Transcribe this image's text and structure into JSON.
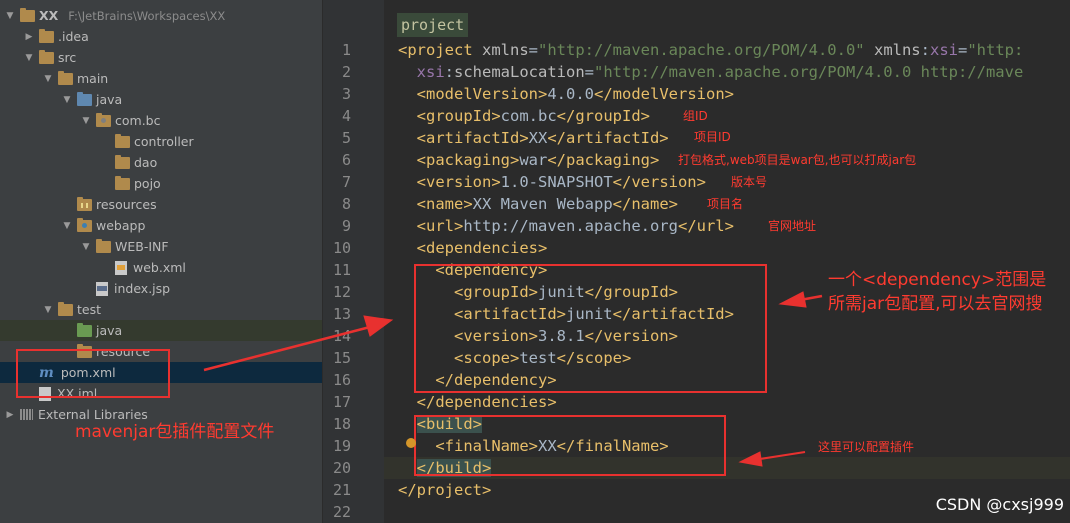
{
  "tree": [
    {
      "label": "XX",
      "extra": "F:\\JetBrains\\Workspaces\\XX",
      "indent": 0,
      "arrow": "▼",
      "icon": "folder",
      "bold": true
    },
    {
      "label": ".idea",
      "indent": 1,
      "arrow": "▶",
      "icon": "folder"
    },
    {
      "label": "src",
      "indent": 1,
      "arrow": "▼",
      "icon": "folder"
    },
    {
      "label": "main",
      "indent": 2,
      "arrow": "▼",
      "icon": "folder"
    },
    {
      "label": "java",
      "indent": 3,
      "arrow": "▼",
      "icon": "folder-blue"
    },
    {
      "label": "com.bc",
      "indent": 4,
      "arrow": "▼",
      "icon": "folder-pkg"
    },
    {
      "label": "controller",
      "indent": 5,
      "arrow": "",
      "icon": "folder"
    },
    {
      "label": "dao",
      "indent": 5,
      "arrow": "",
      "icon": "folder"
    },
    {
      "label": "pojo",
      "indent": 5,
      "arrow": "",
      "icon": "folder"
    },
    {
      "label": "resources",
      "indent": 3,
      "arrow": "",
      "icon": "folder-res"
    },
    {
      "label": "webapp",
      "indent": 3,
      "arrow": "▼",
      "icon": "folder-web"
    },
    {
      "label": "WEB-INF",
      "indent": 4,
      "arrow": "▼",
      "icon": "folder"
    },
    {
      "label": "web.xml",
      "indent": 5,
      "arrow": "",
      "icon": "xml"
    },
    {
      "label": "index.jsp",
      "indent": 4,
      "arrow": "",
      "icon": "jsp"
    },
    {
      "label": "test",
      "indent": 2,
      "arrow": "▼",
      "icon": "folder"
    },
    {
      "label": "java",
      "indent": 3,
      "arrow": "",
      "icon": "folder-green",
      "state": "test-src"
    },
    {
      "label": "resource",
      "indent": 3,
      "arrow": "",
      "icon": "folder"
    },
    {
      "label": "pom.xml",
      "indent": 1,
      "arrow": "",
      "icon": "maven",
      "state": "selected"
    },
    {
      "label": "XX.iml",
      "indent": 1,
      "arrow": "",
      "icon": "iml"
    },
    {
      "label": "External Libraries",
      "indent": 0,
      "arrow": "▶",
      "icon": "libs"
    }
  ],
  "editor": {
    "breadcrumb": "project",
    "line_numbers": [
      "1",
      "2",
      "3",
      "4",
      "5",
      "6",
      "7",
      "8",
      "9",
      "10",
      "11",
      "12",
      "13",
      "14",
      "15",
      "16",
      "17",
      "18",
      "19",
      "20",
      "21",
      "22"
    ],
    "lines": [
      [
        [
          "tag",
          "<project "
        ],
        [
          "attr",
          "xmlns"
        ],
        [
          "txt",
          "="
        ],
        [
          "val",
          "\"http://maven.apache.org/POM/4.0.0\""
        ],
        [
          "txt",
          " "
        ],
        [
          "attr",
          "xmlns"
        ],
        [
          "txt",
          ":"
        ],
        [
          "ns",
          "xsi"
        ],
        [
          "txt",
          "="
        ],
        [
          "val",
          "\"http:"
        ]
      ],
      [
        [
          "txt",
          "  "
        ],
        [
          "ns",
          "xsi"
        ],
        [
          "txt",
          ":"
        ],
        [
          "attr",
          "schemaLocation"
        ],
        [
          "txt",
          "="
        ],
        [
          "val",
          "\"http://maven.apache.org/POM/4.0.0 http://mave"
        ]
      ],
      [
        [
          "txt",
          "  "
        ],
        [
          "tag",
          "<modelVersion>"
        ],
        [
          "txt",
          "4.0.0"
        ],
        [
          "tag",
          "</modelVersion>"
        ]
      ],
      [
        [
          "txt",
          "  "
        ],
        [
          "tag",
          "<groupId>"
        ],
        [
          "txt",
          "com.bc"
        ],
        [
          "tag",
          "</groupId>"
        ]
      ],
      [
        [
          "txt",
          "  "
        ],
        [
          "tag",
          "<artifactId>"
        ],
        [
          "txt",
          "XX"
        ],
        [
          "tag",
          "</artifactId>"
        ]
      ],
      [
        [
          "txt",
          "  "
        ],
        [
          "tag",
          "<packaging>"
        ],
        [
          "txt",
          "war"
        ],
        [
          "tag",
          "</packaging>"
        ]
      ],
      [
        [
          "txt",
          "  "
        ],
        [
          "tag",
          "<version>"
        ],
        [
          "txt",
          "1.0-SNAPSHOT"
        ],
        [
          "tag",
          "</version>"
        ]
      ],
      [
        [
          "txt",
          "  "
        ],
        [
          "tag",
          "<name>"
        ],
        [
          "txt",
          "XX Maven Webapp"
        ],
        [
          "tag",
          "</name>"
        ]
      ],
      [
        [
          "txt",
          "  "
        ],
        [
          "tag",
          "<url>"
        ],
        [
          "txt",
          "http://maven.apache.org"
        ],
        [
          "tag",
          "</url>"
        ]
      ],
      [
        [
          "txt",
          "  "
        ],
        [
          "tag",
          "<dependencies>"
        ]
      ],
      [
        [
          "txt",
          "    "
        ],
        [
          "tag",
          "<dependency>"
        ]
      ],
      [
        [
          "txt",
          "      "
        ],
        [
          "tag",
          "<groupId>"
        ],
        [
          "txt",
          "junit"
        ],
        [
          "tag",
          "</groupId>"
        ]
      ],
      [
        [
          "txt",
          "      "
        ],
        [
          "tag",
          "<artifactId>"
        ],
        [
          "txt",
          "junit"
        ],
        [
          "tag",
          "</artifactId>"
        ]
      ],
      [
        [
          "txt",
          "      "
        ],
        [
          "tag",
          "<version>"
        ],
        [
          "txt",
          "3.8.1"
        ],
        [
          "tag",
          "</version>"
        ]
      ],
      [
        [
          "txt",
          "      "
        ],
        [
          "tag",
          "<scope>"
        ],
        [
          "txt",
          "test"
        ],
        [
          "tag",
          "</scope>"
        ]
      ],
      [
        [
          "txt",
          "    "
        ],
        [
          "tag",
          "</dependency>"
        ]
      ],
      [
        [
          "txt",
          "  "
        ],
        [
          "tag",
          "</dependencies>"
        ]
      ],
      [
        [
          "txt",
          "  "
        ],
        [
          "tag",
          "<build>"
        ]
      ],
      [
        [
          "txt",
          "    "
        ],
        [
          "tag",
          "<finalName>"
        ],
        [
          "txt",
          "XX"
        ],
        [
          "tag",
          "</finalName>"
        ]
      ],
      [
        [
          "txt",
          "  "
        ],
        [
          "tag",
          "</build>"
        ]
      ],
      [
        [
          "tag",
          "</project>"
        ]
      ],
      []
    ]
  },
  "annotations": {
    "group_id": "组ID",
    "artifact_id": "项目ID",
    "packaging": "打包格式,web项目是war包,也可以打成jar包",
    "version": "版本号",
    "name": "项目名",
    "url": "官网地址",
    "dependency_line1": "一个<dependency>范围是",
    "dependency_line2": "所需jar包配置,可以去官网搜",
    "build": "这里可以配置插件",
    "pom": "mavenjar包插件配置文件"
  },
  "watermark": "CSDN @cxsj999",
  "colors": {
    "annotation": "#ff3b30",
    "box": "#e8312f",
    "tag": "#e8bf6a",
    "value": "#6a8759"
  }
}
